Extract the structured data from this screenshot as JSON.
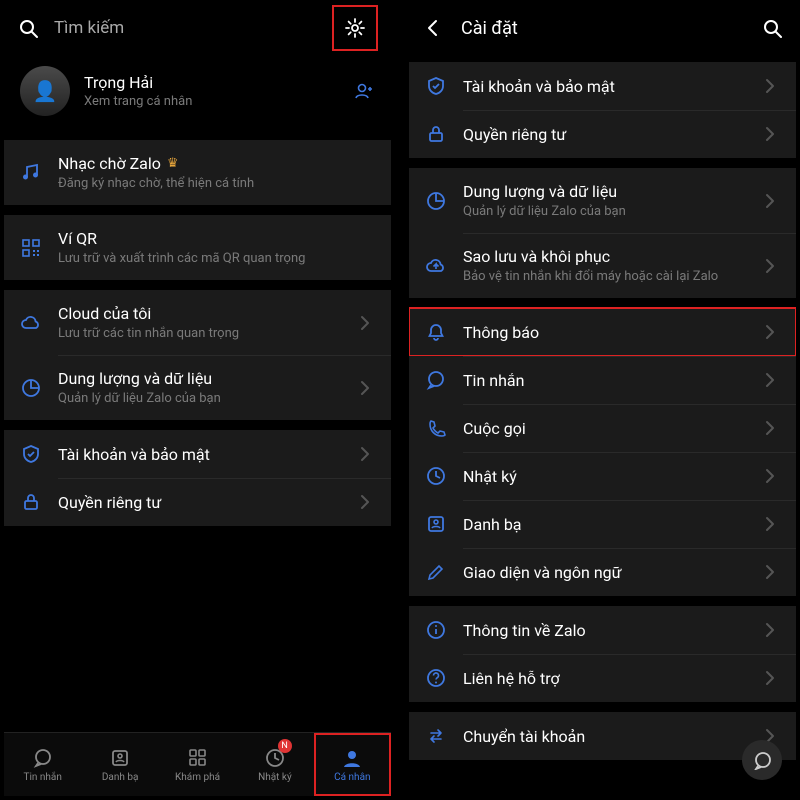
{
  "left": {
    "search_placeholder": "Tìm kiếm",
    "profile": {
      "name": "Trọng Hải",
      "sub": "Xem trang cá nhân"
    },
    "rows": {
      "music": {
        "title": "Nhạc chờ Zalo",
        "sub": "Đăng ký nhạc chờ, thể hiện cá tính"
      },
      "qr": {
        "title": "Ví QR",
        "sub": "Lưu trữ và xuất trình các mã QR quan trọng"
      },
      "cloud": {
        "title": "Cloud của tôi",
        "sub": "Lưu trữ các tin nhắn quan trọng"
      },
      "storage": {
        "title": "Dung lượng và dữ liệu",
        "sub": "Quản lý dữ liệu Zalo của bạn"
      },
      "account": {
        "title": "Tài khoản và bảo mật"
      },
      "privacy": {
        "title": "Quyền riêng tư"
      }
    },
    "tabs": {
      "messages": "Tin nhắn",
      "contacts": "Danh bạ",
      "discover": "Khám phá",
      "diary": "Nhật ký",
      "diary_badge": "N",
      "me": "Cá nhân"
    }
  },
  "right": {
    "title": "Cài đặt",
    "rows": {
      "account": {
        "title": "Tài khoản và bảo mật"
      },
      "privacy": {
        "title": "Quyền riêng tư"
      },
      "storage": {
        "title": "Dung lượng và dữ liệu",
        "sub": "Quản lý dữ liệu Zalo của bạn"
      },
      "backup": {
        "title": "Sao lưu và khôi phục",
        "sub": "Bảo vệ tin nhắn khi đổi máy hoặc cài lại Zalo"
      },
      "notif": {
        "title": "Thông báo"
      },
      "msg": {
        "title": "Tin nhắn"
      },
      "call": {
        "title": "Cuộc gọi"
      },
      "diary": {
        "title": "Nhật ký"
      },
      "contacts": {
        "title": "Danh bạ"
      },
      "theme": {
        "title": "Giao diện và ngôn ngữ"
      },
      "about": {
        "title": "Thông tin về Zalo"
      },
      "support": {
        "title": "Liên hệ hỗ trợ"
      },
      "switch": {
        "title": "Chuyển tài khoản"
      }
    }
  }
}
